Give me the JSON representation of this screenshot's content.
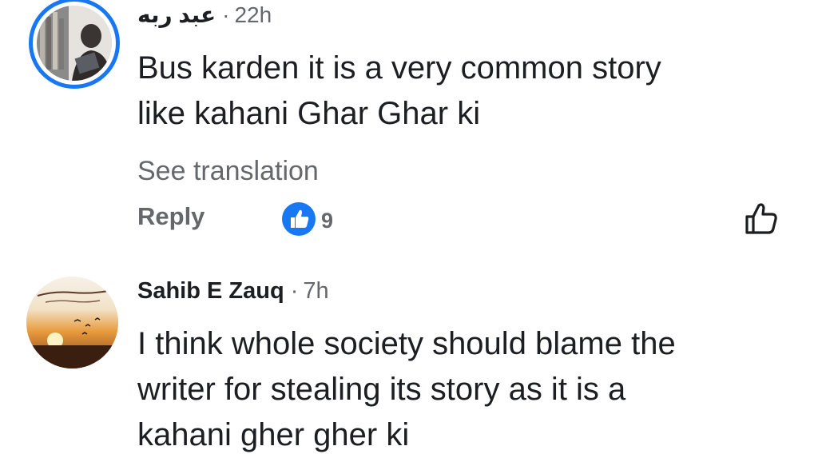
{
  "comments": [
    {
      "author": "عبد ربه",
      "separator": "·",
      "time": "22h",
      "text": "Bus karden it is a very common story\nlike kahani Ghar Ghar ki",
      "see_translation": "See translation",
      "reply_label": "Reply",
      "reaction_count": "9",
      "reaction_icon": "like-reaction-icon",
      "like_button_icon": "thumbs-up-outline-icon"
    },
    {
      "author": "Sahib E Zauq",
      "separator": "·",
      "time": "7h",
      "text": "I think whole society should blame the\nwriter for stealing its story as it is a\nkahani gher gher ki"
    }
  ],
  "colors": {
    "text_primary": "#1c1e21",
    "text_secondary": "#65676b",
    "facebook_blue": "#1877f2",
    "avatar_ring": "#1877f2"
  }
}
